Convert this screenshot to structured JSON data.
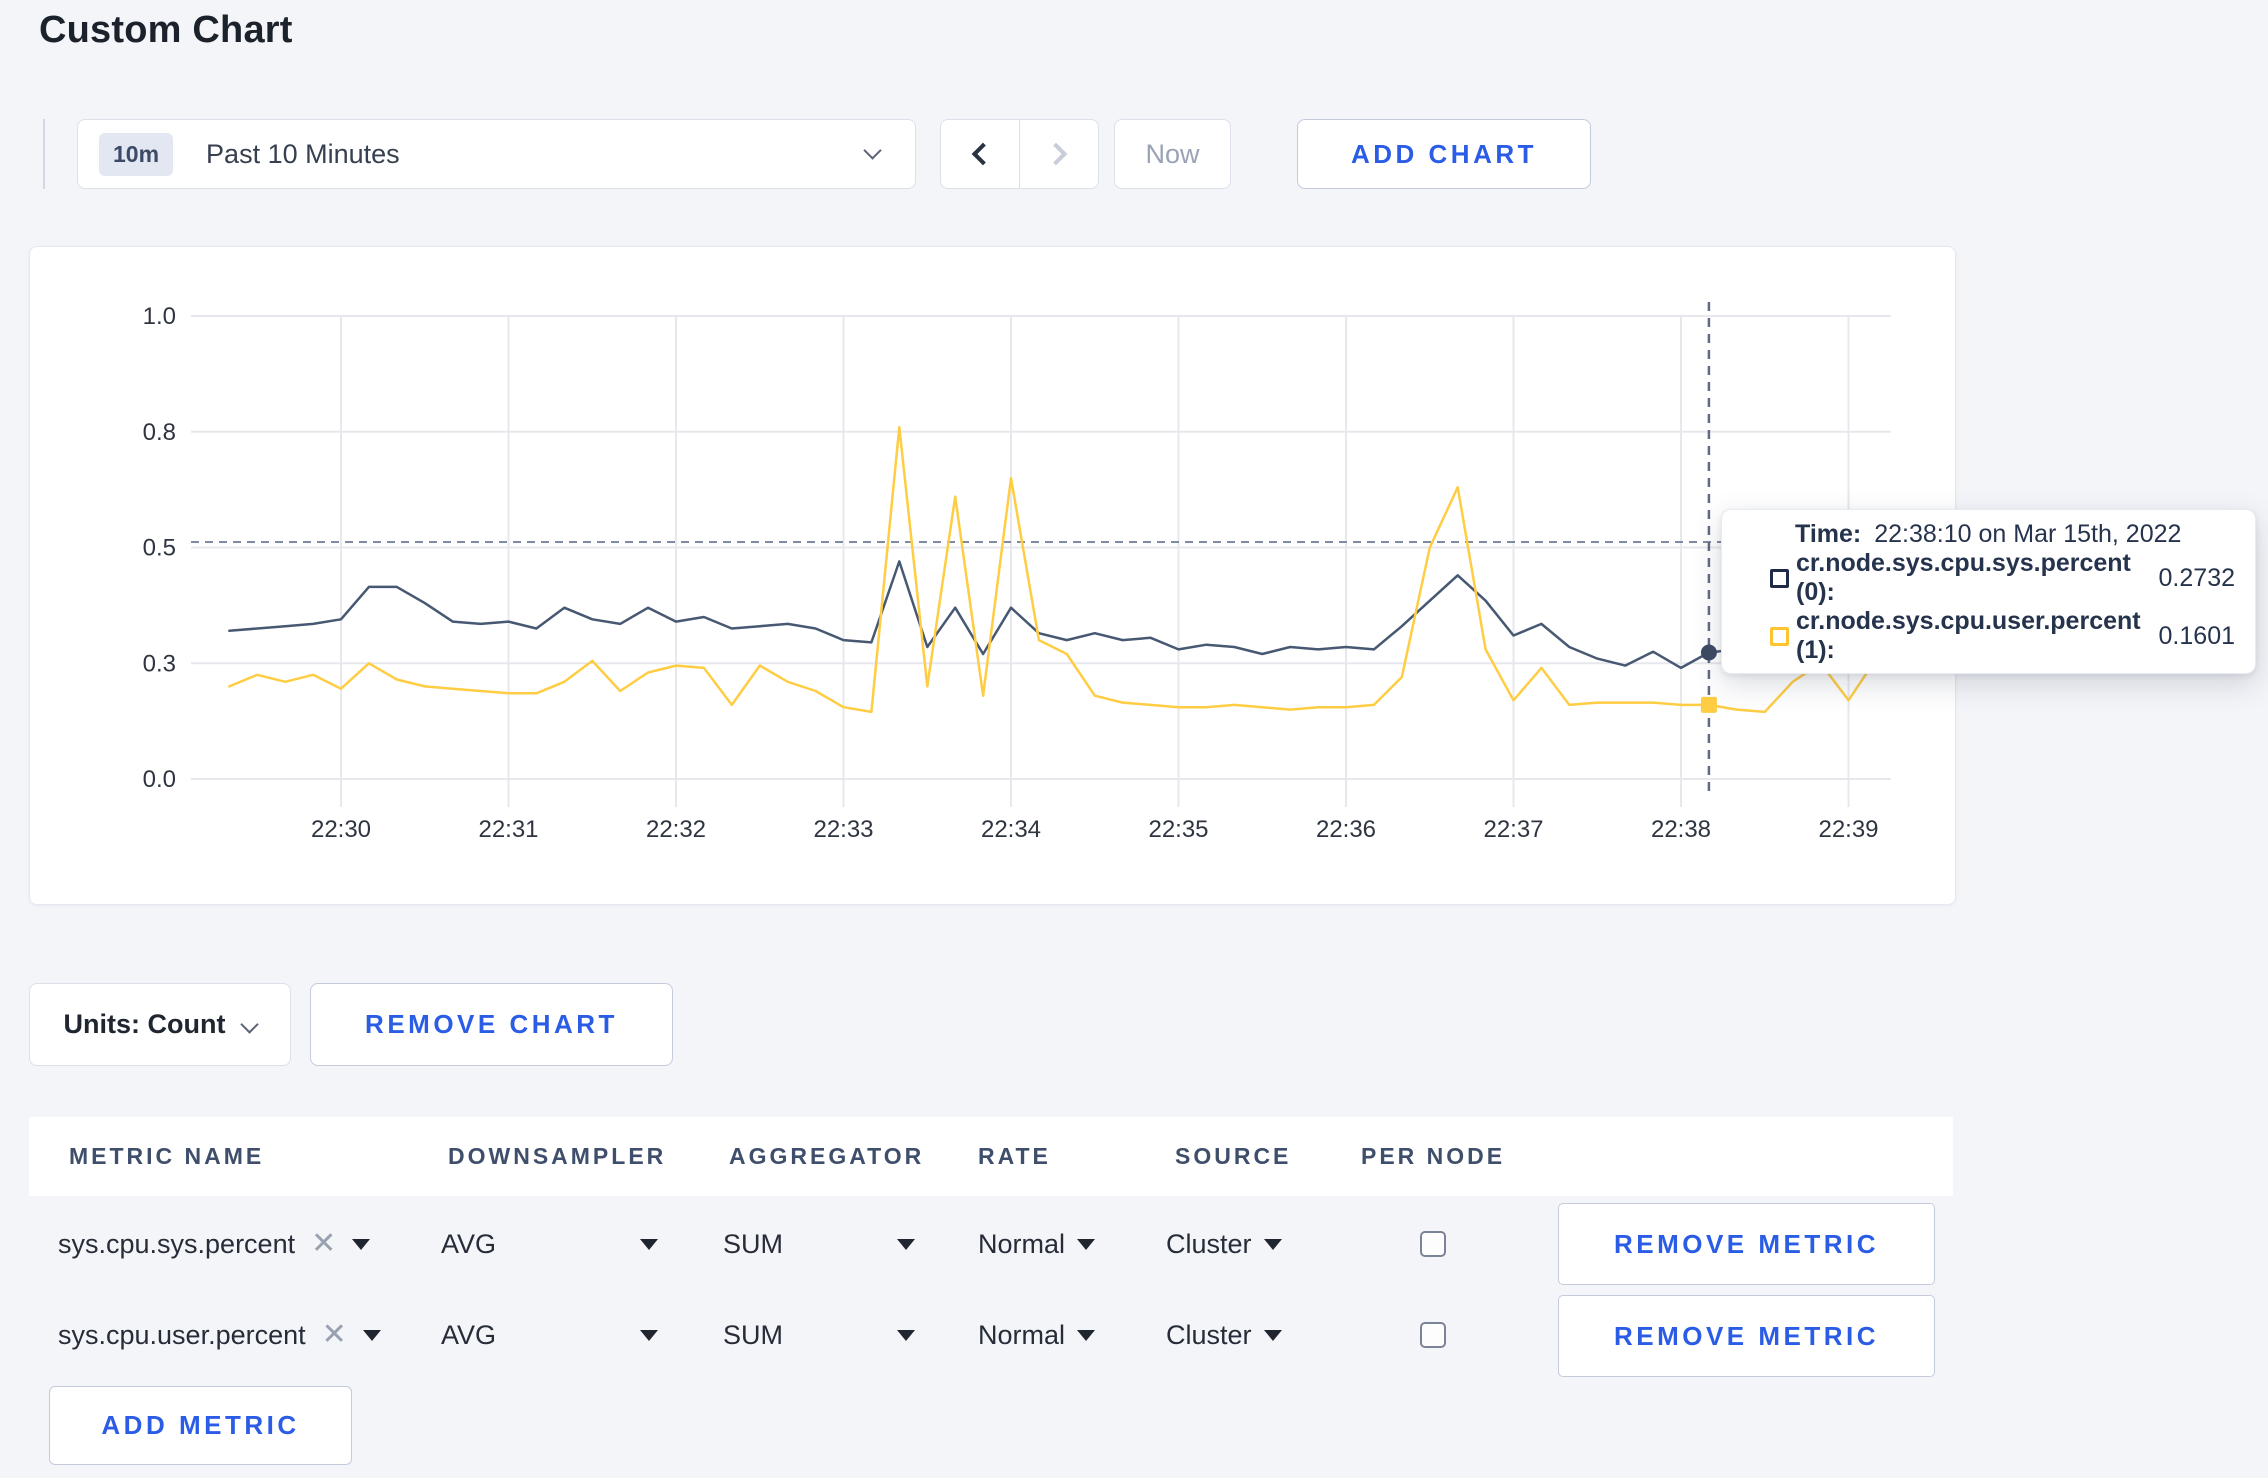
{
  "page": {
    "title": "Custom Chart"
  },
  "toolbar": {
    "time_window_badge": "10m",
    "time_window_label": "Past 10 Minutes",
    "now_label": "Now",
    "add_chart_label": "ADD CHART"
  },
  "chart": {
    "tooltip": {
      "time_label": "Time:",
      "time_value": "22:38:10 on Mar 15th, 2022",
      "series": [
        {
          "label": "cr.node.sys.cpu.sys.percent (0):",
          "value": "0.2732",
          "color": "#1f2a48"
        },
        {
          "label": "cr.node.sys.cpu.user.percent (1):",
          "value": "0.1601",
          "color": "#ffc531"
        }
      ]
    }
  },
  "chart_data": {
    "type": "line",
    "title": "",
    "xlabel": "",
    "ylabel": "",
    "x_axis": {
      "start_time": "22:29:20",
      "interval_seconds": 10,
      "points": 60
    },
    "x_tick_labels": [
      "22:30",
      "22:31",
      "22:32",
      "22:33",
      "22:34",
      "22:35",
      "22:36",
      "22:37",
      "22:38",
      "22:39"
    ],
    "y_axis": {
      "range": [
        0,
        1
      ],
      "tick_values": [
        0,
        0.25,
        0.5,
        0.75,
        1
      ],
      "tick_labels": [
        "0.0",
        "0.3",
        "0.5",
        "0.8",
        "1.0"
      ]
    },
    "grid": true,
    "legend_position": "tooltip-only",
    "series": [
      {
        "name": "cr.node.sys.cpu.sys.percent",
        "color": "#475872",
        "values": [
          0.32,
          0.325,
          0.33,
          0.335,
          0.345,
          0.415,
          0.415,
          0.38,
          0.34,
          0.335,
          0.34,
          0.325,
          0.37,
          0.345,
          0.335,
          0.37,
          0.34,
          0.35,
          0.325,
          0.33,
          0.335,
          0.325,
          0.3,
          0.295,
          0.47,
          0.285,
          0.37,
          0.27,
          0.37,
          0.315,
          0.3,
          0.315,
          0.3,
          0.305,
          0.28,
          0.29,
          0.285,
          0.27,
          0.285,
          0.28,
          0.285,
          0.28,
          0.33,
          0.385,
          0.44,
          0.385,
          0.31,
          0.335,
          0.285,
          0.26,
          0.245,
          0.275,
          0.24,
          0.2732,
          0.28,
          0.27,
          0.29,
          0.28,
          0.27,
          0.28
        ]
      },
      {
        "name": "cr.node.sys.cpu.user.percent",
        "color": "#ffcd44",
        "values": [
          0.2,
          0.225,
          0.21,
          0.225,
          0.195,
          0.25,
          0.215,
          0.2,
          0.195,
          0.19,
          0.185,
          0.185,
          0.21,
          0.255,
          0.19,
          0.23,
          0.245,
          0.24,
          0.16,
          0.245,
          0.21,
          0.19,
          0.155,
          0.145,
          0.76,
          0.2,
          0.61,
          0.18,
          0.65,
          0.3,
          0.27,
          0.18,
          0.165,
          0.16,
          0.155,
          0.155,
          0.16,
          0.155,
          0.15,
          0.155,
          0.155,
          0.16,
          0.22,
          0.5,
          0.63,
          0.28,
          0.17,
          0.24,
          0.16,
          0.165,
          0.165,
          0.165,
          0.16,
          0.1601,
          0.15,
          0.145,
          0.21,
          0.25,
          0.17,
          0.26
        ]
      }
    ],
    "crosshair": {
      "x_time": "22:38:10",
      "y_value": 0.512
    },
    "hover_points": [
      {
        "series": 0,
        "time": "22:38:10",
        "value": 0.2732,
        "marker": "circle"
      },
      {
        "series": 1,
        "time": "22:38:10",
        "value": 0.1601,
        "marker": "square"
      }
    ]
  },
  "units": {
    "label": "Units: Count"
  },
  "actions": {
    "remove_chart_label": "REMOVE CHART",
    "add_metric_label": "ADD METRIC"
  },
  "table": {
    "headers": [
      "METRIC NAME",
      "DOWNSAMPLER",
      "AGGREGATOR",
      "RATE",
      "SOURCE",
      "PER NODE"
    ],
    "rows": [
      {
        "metric": "sys.cpu.sys.percent",
        "downsampler": "AVG",
        "aggregator": "SUM",
        "rate": "Normal",
        "source": "Cluster",
        "per_node_checked": false,
        "remove_label": "REMOVE METRIC"
      },
      {
        "metric": "sys.cpu.user.percent",
        "downsampler": "AVG",
        "aggregator": "SUM",
        "rate": "Normal",
        "source": "Cluster",
        "per_node_checked": false,
        "remove_label": "REMOVE METRIC"
      }
    ]
  }
}
